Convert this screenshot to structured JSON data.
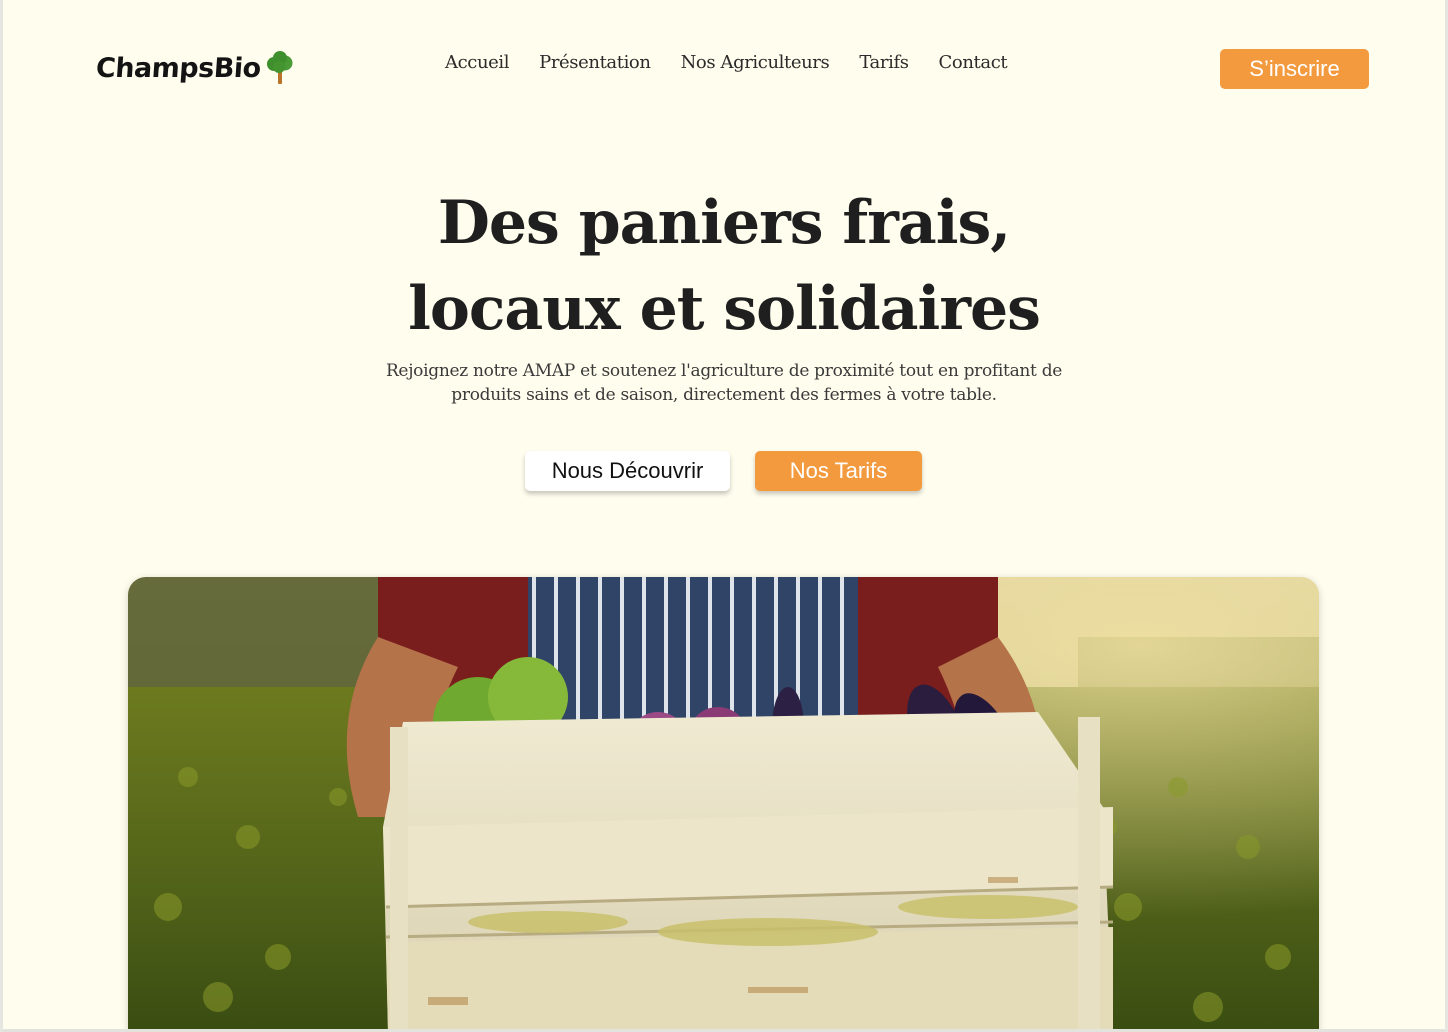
{
  "brand": {
    "name": "ChampsBio",
    "logo_icon": "tree-icon"
  },
  "nav": {
    "items": [
      "Accueil",
      "Présentation",
      "Nos Agriculteurs",
      "Tarifs",
      "Contact"
    ]
  },
  "header": {
    "signup_label": "S’inscrire"
  },
  "hero": {
    "title_line1": "Des paniers frais,",
    "title_line2": "locaux et solidaires",
    "subtitle": "Rejoignez notre AMAP et soutenez l'agriculture de proximité tout en profitant de produits sains et de saison, directement des fermes à votre table.",
    "primary_button": "Nous Découvrir",
    "secondary_button": "Nos Tarifs",
    "image_subject": "farmer-holding-vegetable-crate"
  },
  "colors": {
    "background": "#fffded",
    "accent": "#f39a3f",
    "text": "#1f1f1f",
    "tree_green": "#3f8f2f",
    "tree_trunk": "#b8752a"
  }
}
